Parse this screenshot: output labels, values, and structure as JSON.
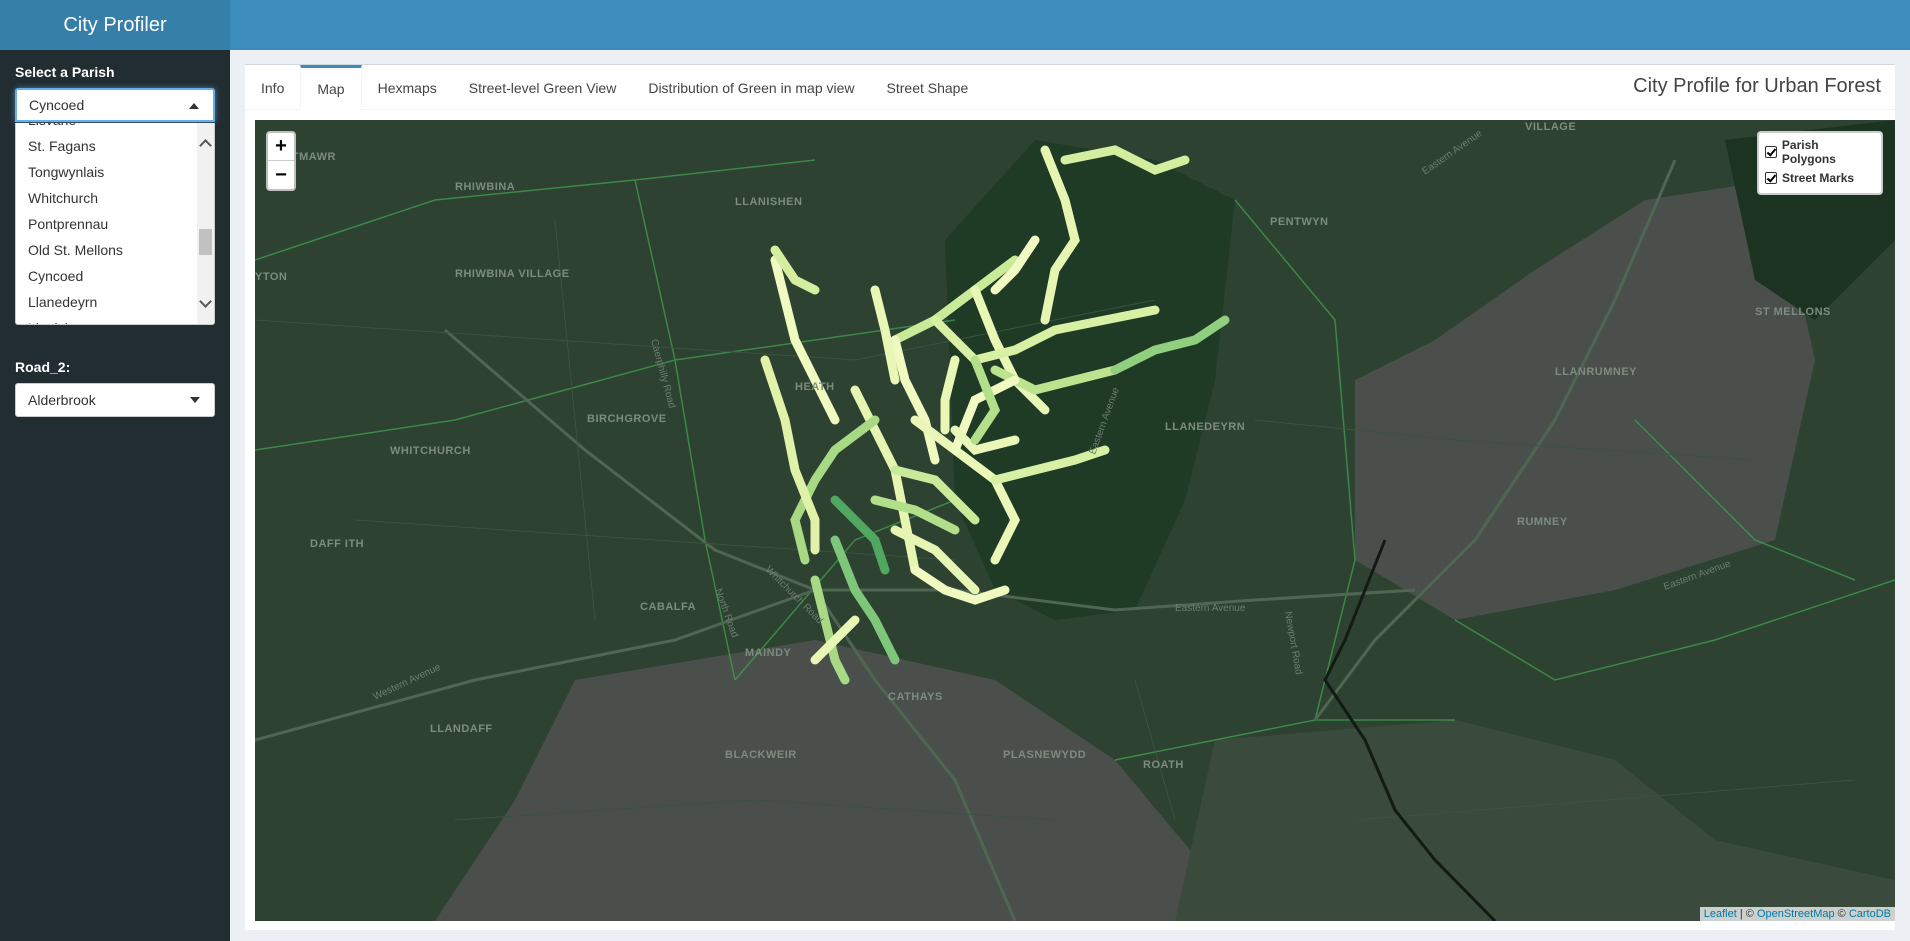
{
  "app": {
    "title": "City Profiler"
  },
  "sidebar": {
    "parish_label": "Select a Parish",
    "parish_selected": "Cyncoed",
    "parish_options": [
      "Lisvane",
      "St. Fagans",
      "Tongwynlais",
      "Whitchurch",
      "Pontprennau",
      "Old St. Mellons",
      "Cyncoed",
      "Llanedeyrn",
      "Llanishen"
    ],
    "road_label": "Road_2:",
    "road_selected": "Alderbrook"
  },
  "tabs": [
    "Info",
    "Map",
    "Hexmaps",
    "Street-level Green View",
    "Distribution of Green in map view",
    "Street Shape"
  ],
  "active_tab": "Map",
  "box_title": "City Profile for Urban Forest",
  "map": {
    "zoom_in": "+",
    "zoom_out": "−",
    "layers": [
      "Parish Polygons",
      "Street Marks"
    ],
    "attribution": {
      "leaflet": "Leaflet",
      "sep": " | © ",
      "osm": "OpenStreetMap",
      "sep2": " © ",
      "carto": "CartoDB"
    },
    "places": [
      "VILLAGE",
      "ANTMAWR",
      "RHIWBINA",
      "LLANISHEN",
      "PENTWYN",
      "RHIWBINA VILLAGE",
      "YTON",
      "ST MELLONS",
      "LLANRUMNEY",
      "HEATH",
      "BIRCHGROVE",
      "WHITCHURCH",
      "LLANEDEYRN",
      "RUMNEY",
      "DAFF ITH",
      "CABALFA",
      "MAINDY",
      "CATHAYS",
      "LLANDAFF",
      "BLACKWEIR",
      "PLASNEWYDD",
      "ROATH"
    ],
    "roads": [
      "Eastern Avenue",
      "Eastern Avenue",
      "Eastern Avenue",
      "Western Avenue",
      "North Road",
      "Whitchurch Road",
      "Caerphilly Road",
      "Eastern Avenue",
      "Newport Road"
    ]
  },
  "colors": {
    "logo": "#367fa9",
    "header": "#3c8dbc",
    "sidebar": "#222d32",
    "map_bg": "#2c3f2e",
    "street_light": "#e8f5b0",
    "street_dark": "#2e8b57"
  }
}
